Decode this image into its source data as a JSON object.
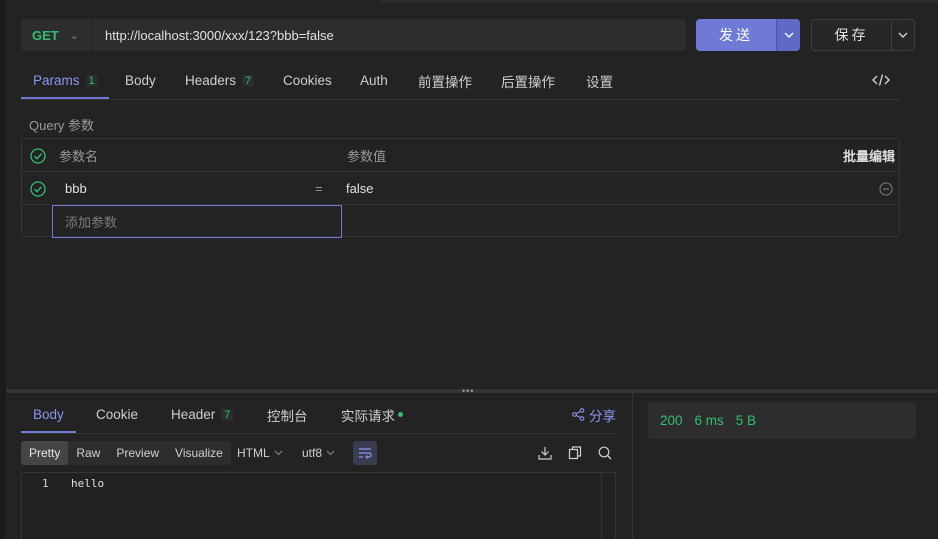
{
  "request": {
    "method": "GET",
    "url": "http://localhost:3000/xxx/123?bbb=false",
    "send_label": "发送",
    "save_label": "保存"
  },
  "request_tabs": [
    {
      "label": "Params",
      "count": "1"
    },
    {
      "label": "Body"
    },
    {
      "label": "Headers",
      "count": "7"
    },
    {
      "label": "Cookies"
    },
    {
      "label": "Auth"
    },
    {
      "label": "前置操作"
    },
    {
      "label": "后置操作"
    },
    {
      "label": "设置"
    }
  ],
  "params": {
    "section_title": "Query 参数",
    "header_name": "参数名",
    "header_value": "参数值",
    "bulk_edit": "批量编辑",
    "rows": [
      {
        "name": "bbb",
        "separator": "=",
        "value": "false",
        "enabled": true
      }
    ],
    "add_placeholder": "添加参数"
  },
  "response_tabs": [
    {
      "label": "Body"
    },
    {
      "label": "Cookie"
    },
    {
      "label": "Header",
      "count": "7"
    },
    {
      "label": "控制台"
    },
    {
      "label": "实际请求"
    }
  ],
  "share_label": "分享",
  "view_modes": [
    "Pretty",
    "Raw",
    "Preview",
    "Visualize"
  ],
  "active_view_mode": "Pretty",
  "format_select": "HTML",
  "encoding_select": "utf8",
  "body_lines": [
    {
      "no": "1",
      "text": "hello"
    }
  ],
  "status": {
    "code": "200",
    "time": "6 ms",
    "size": "5 B"
  },
  "colors": {
    "accent": "#6f7ad6",
    "accent_text": "#8b96ee",
    "success": "#2fbf71",
    "background": "#232323"
  }
}
